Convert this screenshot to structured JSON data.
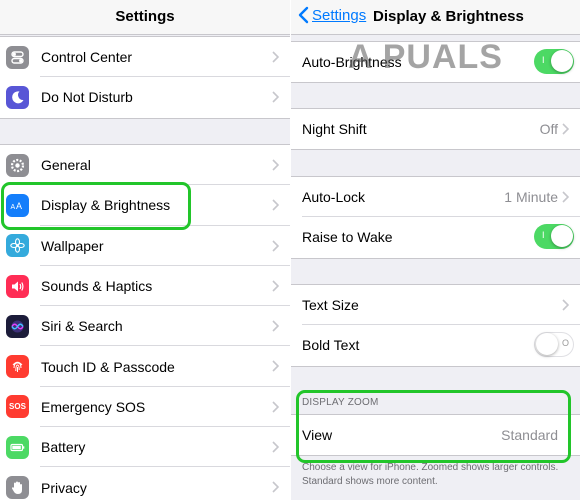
{
  "settings": {
    "title": "Settings",
    "group1": [
      {
        "label": "Control Center",
        "icon": "toggles-icon",
        "color": "#8e8e93"
      },
      {
        "label": "Do Not Disturb",
        "icon": "moon-icon",
        "color": "#5856d6"
      }
    ],
    "group2": [
      {
        "label": "General",
        "icon": "gear-icon",
        "color": "#8e8e93"
      },
      {
        "label": "Display & Brightness",
        "icon": "text-size-icon",
        "color": "#147efb"
      },
      {
        "label": "Wallpaper",
        "icon": "flower-icon",
        "color": "#34aadc"
      },
      {
        "label": "Sounds & Haptics",
        "icon": "speaker-icon",
        "color": "#ff2d55"
      },
      {
        "label": "Siri & Search",
        "icon": "siri-icon",
        "color": "#1c1c3a"
      },
      {
        "label": "Touch ID & Passcode",
        "icon": "fingerprint-icon",
        "color": "#ff3b30"
      },
      {
        "label": "Emergency SOS",
        "icon": "sos-icon",
        "sos_text": "SOS",
        "color": "#ff3b30"
      },
      {
        "label": "Battery",
        "icon": "battery-icon",
        "color": "#4cd964"
      },
      {
        "label": "Privacy",
        "icon": "hand-icon",
        "color": "#8e8e93"
      }
    ]
  },
  "display": {
    "back_label": "Settings",
    "title": "Display & Brightness",
    "auto_brightness": {
      "label": "Auto-Brightness",
      "on": true
    },
    "night_shift": {
      "label": "Night Shift",
      "value": "Off"
    },
    "auto_lock": {
      "label": "Auto-Lock",
      "value": "1 Minute"
    },
    "raise_to_wake": {
      "label": "Raise to Wake",
      "on": true
    },
    "text_size": {
      "label": "Text Size"
    },
    "bold_text": {
      "label": "Bold Text",
      "on": false
    },
    "display_zoom_header": "DISPLAY ZOOM",
    "view": {
      "label": "View",
      "value": "Standard"
    },
    "zoom_footer": "Choose a view for iPhone. Zoomed shows larger controls. Standard shows more content."
  },
  "toggle_marks": {
    "on": "I",
    "off": "O"
  },
  "watermark": "A PUALS",
  "colors": {
    "accent": "#007aff",
    "toggle_on": "#4cd964",
    "highlight": "#22c52a"
  }
}
